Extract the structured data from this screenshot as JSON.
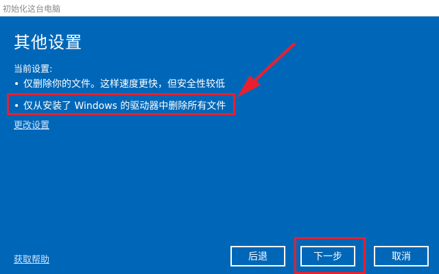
{
  "window": {
    "title": "初始化这台电脑"
  },
  "panel": {
    "heading": "其他设置",
    "current_label": "当前设置:",
    "bullets": [
      "仅删除你的文件。这样速度更快，但安全性较低",
      "仅从安装了 Windows 的驱动器中删除所有文件"
    ],
    "bullet_glyph": "•",
    "change_settings_link": "更改设置",
    "help_link": "获取帮助"
  },
  "buttons": {
    "back": "后退",
    "next": "下一步",
    "cancel": "取消"
  },
  "colors": {
    "panel_bg": "#0067b8",
    "annotation_red": "#e8202e",
    "text_white": "#ffffff"
  }
}
